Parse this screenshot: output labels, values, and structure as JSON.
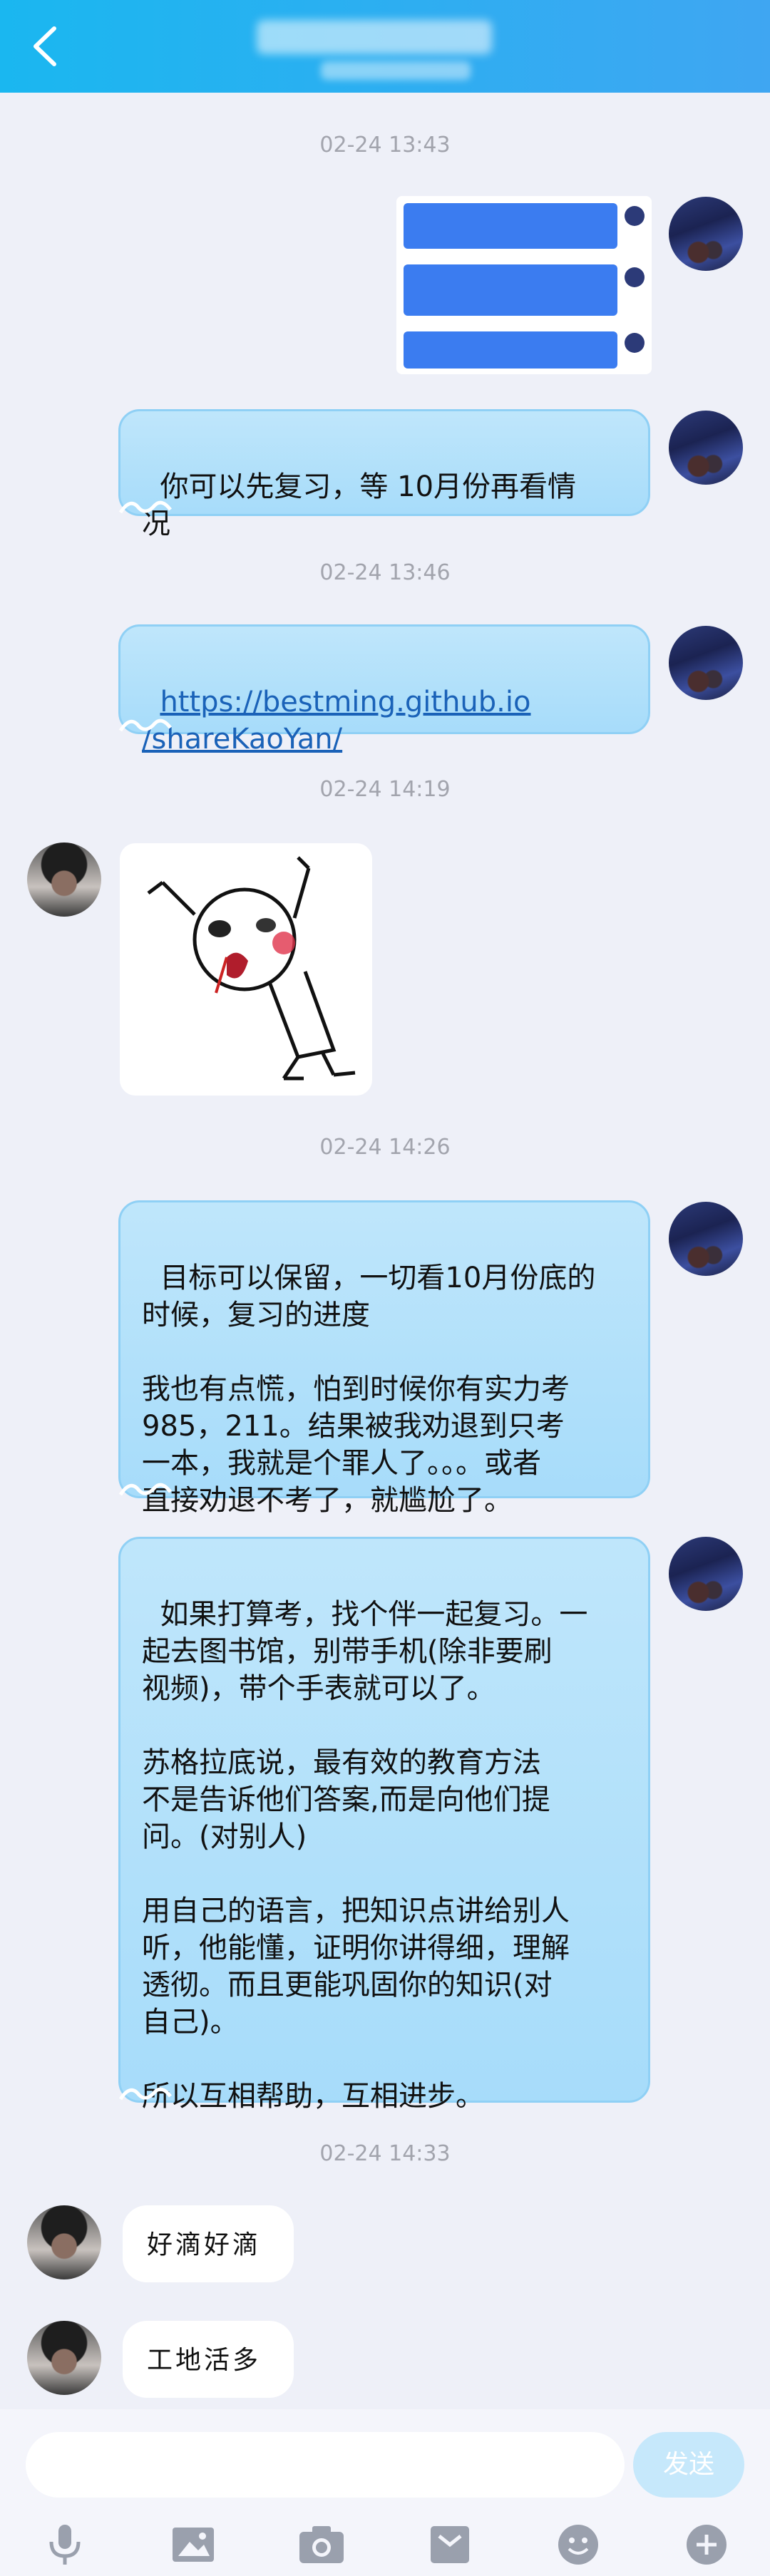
{
  "timestamps": [
    "02-24 13:43",
    "02-24 13:46",
    "02-24 14:19",
    "02-24 14:26",
    "02-24 14:33"
  ],
  "messages": {
    "m1": "你可以先复习，等 10月份再看情\n况",
    "m2_link": "https://bestming.github.io\n/shareKaoYan/",
    "m3": "目标可以保留，一切看10月份底的\n时候，复习的进度\n\n我也有点慌，怕到时候你有实力考\n985，211。结果被我劝退到只考\n一本，我就是个罪人了。。。或者\n直接劝退不考了，就尴尬了。",
    "m4": "如果打算考，找个伴一起复习。一\n起去图书馆，别带手机(除非要刷\n视频)，带个手表就可以了。\n\n苏格拉底说，最有效的教育方法\n不是告诉他们答案,而是向他们提\n问。(对别人)\n\n用自己的语言，把知识点讲给别人\n听，他能懂，证明你讲得细，理解\n透彻。而且更能巩固你的知识(对\n自己)。\n\n所以互相帮助，互相进步。",
    "m5": "好滴好滴",
    "m6": "工地活多"
  },
  "input": {
    "placeholder": "",
    "send_label": "发送"
  },
  "colors": {
    "header": "#1ab7f0",
    "bubble": "#b3e0fa",
    "accent": "#3b7cf0"
  },
  "icons": [
    "back-arrow-icon",
    "microphone-icon",
    "image-icon",
    "camera-icon",
    "file-icon",
    "emoji-icon",
    "plus-icon"
  ]
}
